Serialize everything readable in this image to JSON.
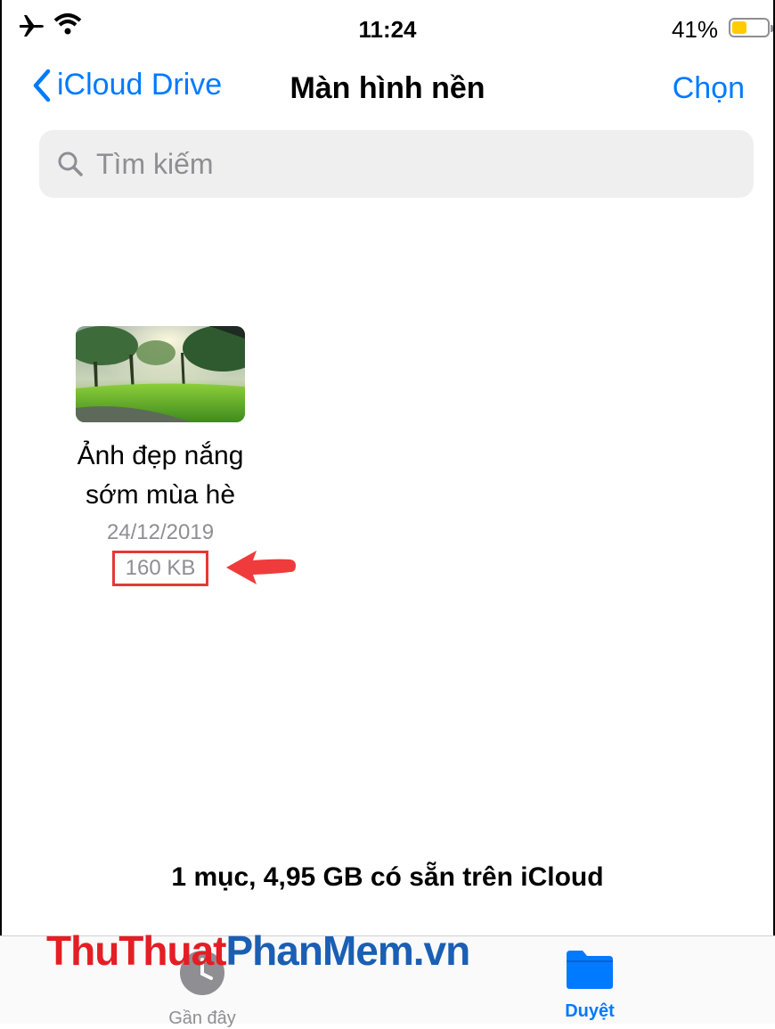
{
  "status_bar": {
    "time": "11:24",
    "battery_percent": "41%",
    "battery_level": 0.41
  },
  "nav": {
    "back_label": "iCloud Drive",
    "title": "Màn hình nền",
    "select_label": "Chọn"
  },
  "search": {
    "placeholder": "Tìm kiếm"
  },
  "files": [
    {
      "name_line1": "Ảnh đẹp nắng",
      "name_line2": "sớm mùa hè",
      "date": "24/12/2019",
      "size": "160 KB"
    }
  ],
  "footer": {
    "info": "1 mục, 4,95 GB có sẵn trên iCloud"
  },
  "tabs": [
    {
      "label": "Gần đây",
      "icon": "clock-icon"
    },
    {
      "label": "Duyệt",
      "icon": "folder-icon"
    }
  ],
  "watermark": {
    "part1": "ThuThuat",
    "part2": "PhanMem.vn"
  },
  "colors": {
    "accent": "#007aff",
    "highlight": "#e53935",
    "battery": "#ffcc00"
  }
}
